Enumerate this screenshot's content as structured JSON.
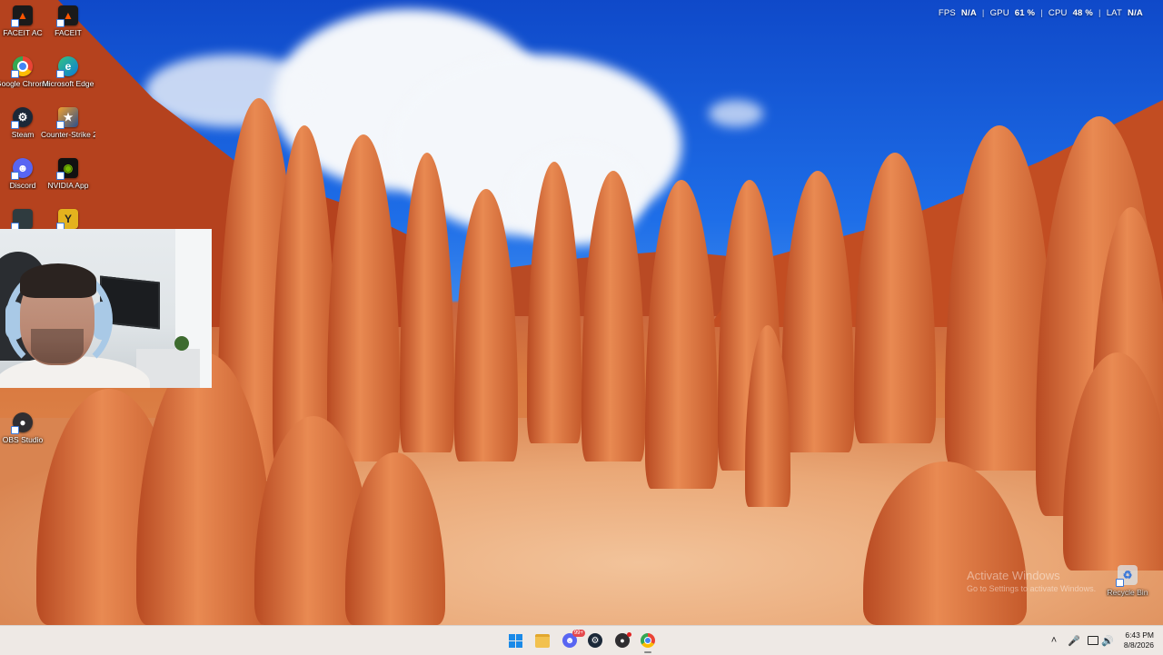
{
  "desktop_icons": [
    {
      "label": "FACEIT AC",
      "icon": "faceit-ac-icon"
    },
    {
      "label": "FACEIT",
      "icon": "faceit-icon"
    },
    {
      "label": "Google Chrome",
      "icon": "chrome-icon"
    },
    {
      "label": "Microsoft Edge",
      "icon": "edge-icon"
    },
    {
      "label": "Steam",
      "icon": "steam-icon"
    },
    {
      "label": "Counter-Strike 2",
      "icon": "counter-strike-icon"
    },
    {
      "label": "Discord",
      "icon": "discord-icon"
    },
    {
      "label": "NVIDIA App",
      "icon": "nvidia-icon"
    },
    {
      "label": "OBS Studio",
      "icon": "obs-icon"
    },
    {
      "label": "Recycle Bin",
      "icon": "recycle-bin-icon"
    }
  ],
  "overlay": {
    "fps_label": "FPS",
    "fps_value": "N/A",
    "gpu_label": "GPU",
    "gpu_value": "61 %",
    "cpu_label": "CPU",
    "cpu_value": "48 %",
    "lat_label": "LAT",
    "lat_value": "N/A",
    "separator": "|"
  },
  "watermark": {
    "line1": "Activate Windows",
    "line2": "Go to Settings to activate Windows."
  },
  "taskbar": {
    "apps": [
      "start-icon",
      "file-explorer-icon",
      "discord-icon",
      "steam-icon",
      "obs-icon",
      "chrome-icon"
    ],
    "discord_badge": "99+",
    "tray": [
      "chevron-up-icon",
      "microphone-icon",
      "display-icon",
      "volume-icon"
    ],
    "time": "6:43 PM",
    "date": "8/8/2026"
  },
  "colors": {
    "taskbar_bg": "#eee9e5",
    "sky": "#1e6ee8",
    "rock": "#c8653e"
  }
}
